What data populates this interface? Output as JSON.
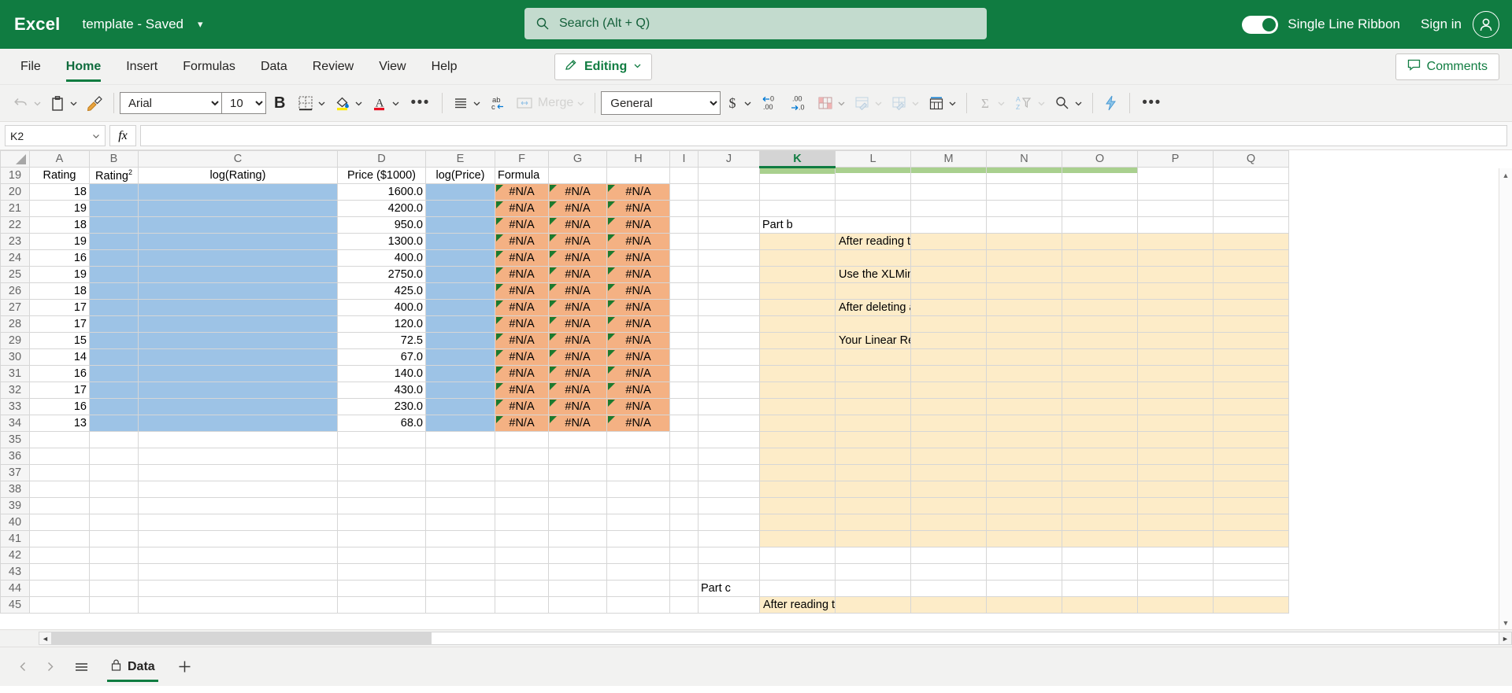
{
  "titlebar": {
    "app_name": "Excel",
    "doc_title": "template  -  Saved",
    "search_placeholder": "Search (Alt + Q)",
    "ribbon_toggle_label": "Single Line Ribbon",
    "signin_label": "Sign in",
    "brand_color": "#107c41"
  },
  "menubar": {
    "items": [
      {
        "label": "File",
        "active": false
      },
      {
        "label": "Home",
        "active": true
      },
      {
        "label": "Insert",
        "active": false
      },
      {
        "label": "Formulas",
        "active": false
      },
      {
        "label": "Data",
        "active": false
      },
      {
        "label": "Review",
        "active": false
      },
      {
        "label": "View",
        "active": false
      },
      {
        "label": "Help",
        "active": false
      }
    ],
    "editing_label": "Editing",
    "comments_label": "Comments"
  },
  "ribbon": {
    "font_name": "Arial",
    "font_size": "10",
    "bold_label": "B",
    "merge_label": "Merge",
    "number_format": "General",
    "overflow_label": "•••"
  },
  "formulabar": {
    "name_box": "K2",
    "fx_label": "fx",
    "formula_value": ""
  },
  "grid": {
    "columns": [
      "A",
      "B",
      "C",
      "D",
      "E",
      "F",
      "G",
      "H",
      "I",
      "J",
      "K",
      "L",
      "M",
      "N",
      "O",
      "P",
      "Q"
    ],
    "selected_column": "K",
    "row_numbers": [
      "19",
      "20",
      "21",
      "22",
      "23",
      "24",
      "25",
      "26",
      "27",
      "28",
      "29",
      "30",
      "31",
      "32",
      "33",
      "34",
      "35",
      "36",
      "37",
      "38",
      "39",
      "40",
      "41",
      "42",
      "43",
      "44",
      "45"
    ],
    "headers": {
      "A": "Rating",
      "B": "Rating",
      "B_superscript": "2",
      "C": "log(Rating)",
      "D": "Price ($1000)",
      "E": "log(Price)",
      "F": "Formula"
    },
    "data_rows": [
      {
        "row": "20",
        "rating": "18",
        "price": "1600.0",
        "na": "#N/A"
      },
      {
        "row": "21",
        "rating": "19",
        "price": "4200.0",
        "na": "#N/A"
      },
      {
        "row": "22",
        "rating": "18",
        "price": "950.0",
        "na": "#N/A"
      },
      {
        "row": "23",
        "rating": "19",
        "price": "1300.0",
        "na": "#N/A"
      },
      {
        "row": "24",
        "rating": "16",
        "price": "400.0",
        "na": "#N/A"
      },
      {
        "row": "25",
        "rating": "19",
        "price": "2750.0",
        "na": "#N/A"
      },
      {
        "row": "26",
        "rating": "18",
        "price": "425.0",
        "na": "#N/A"
      },
      {
        "row": "27",
        "rating": "17",
        "price": "400.0",
        "na": "#N/A"
      },
      {
        "row": "28",
        "rating": "17",
        "price": "120.0",
        "na": "#N/A"
      },
      {
        "row": "29",
        "rating": "15",
        "price": "72.5",
        "na": "#N/A"
      },
      {
        "row": "30",
        "rating": "14",
        "price": "67.0",
        "na": "#N/A"
      },
      {
        "row": "31",
        "rating": "16",
        "price": "140.0",
        "na": "#N/A"
      },
      {
        "row": "32",
        "rating": "17",
        "price": "430.0",
        "na": "#N/A"
      },
      {
        "row": "33",
        "rating": "16",
        "price": "230.0",
        "na": "#N/A"
      },
      {
        "row": "34",
        "rating": "13",
        "price": "68.0",
        "na": "#N/A"
      }
    ],
    "part_b_label": "Part b",
    "part_c_label": "Part c",
    "instructions": [
      "After reading these instructions delete all text in this shaded area.",
      "Use the XLMiner Analysis ToolPak to conduct your Linear Regression analysis.",
      "After deleting all text in this shaded area, set the output range in the ToolPak to the top left cell of this area (K",
      "Your Linear Regression analysis output should fit into this shaded area."
    ],
    "part_c_instruction": "After reading these instructions delete all text in this shaded area.",
    "colors": {
      "blue_fill": "#9dc3e6",
      "orange_fill": "#f4b183",
      "cream_fill": "#fdecc8",
      "selection_green": "#a9d08e"
    }
  },
  "tabsbar": {
    "sheet_name": "Data",
    "add_sheet_label": "+"
  }
}
